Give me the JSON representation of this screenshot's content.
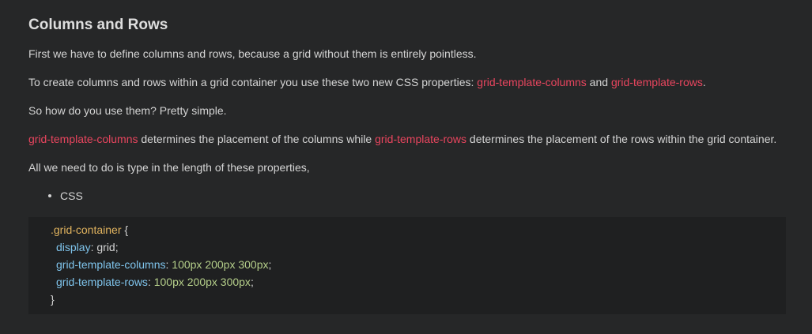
{
  "heading": "Columns and Rows",
  "p1": "First we have to define columns and rows, because a grid without them is entirely pointless.",
  "p2": {
    "before": "To create columns and rows within a grid container you use these two new CSS properties: ",
    "kw1": "grid-template-columns",
    "mid": " and ",
    "kw2": "grid-template-rows",
    "after": "."
  },
  "p3": "So how do you use them? Pretty simple.",
  "p4": {
    "kw1": "grid-template-columns",
    "mid": " determines the placement of the columns while ",
    "kw2": "grid-template-rows",
    "after": " determines the placement of the rows within the grid container."
  },
  "p5": "All we need to do is type in the length of these properties,",
  "list": {
    "items": [
      "CSS"
    ]
  },
  "code": {
    "selector": ".grid-container",
    "open_brace": " {",
    "lines": [
      {
        "prop": "display",
        "colon": ": ",
        "value": "grid",
        "semi": ";"
      },
      {
        "prop": "grid-template-columns",
        "colon": ": ",
        "value": "100px 200px 300px",
        "semi": ";"
      },
      {
        "prop": "grid-template-rows",
        "colon": ": ",
        "value": "100px 200px 300px",
        "semi": ";"
      }
    ],
    "close_brace": "}"
  },
  "colors": {
    "background": "#262728",
    "code_background": "#1f2021",
    "keyword": "#e8455e",
    "selector": "#e2b45f",
    "property": "#7fc4ec",
    "number": "#b5cf8a"
  }
}
